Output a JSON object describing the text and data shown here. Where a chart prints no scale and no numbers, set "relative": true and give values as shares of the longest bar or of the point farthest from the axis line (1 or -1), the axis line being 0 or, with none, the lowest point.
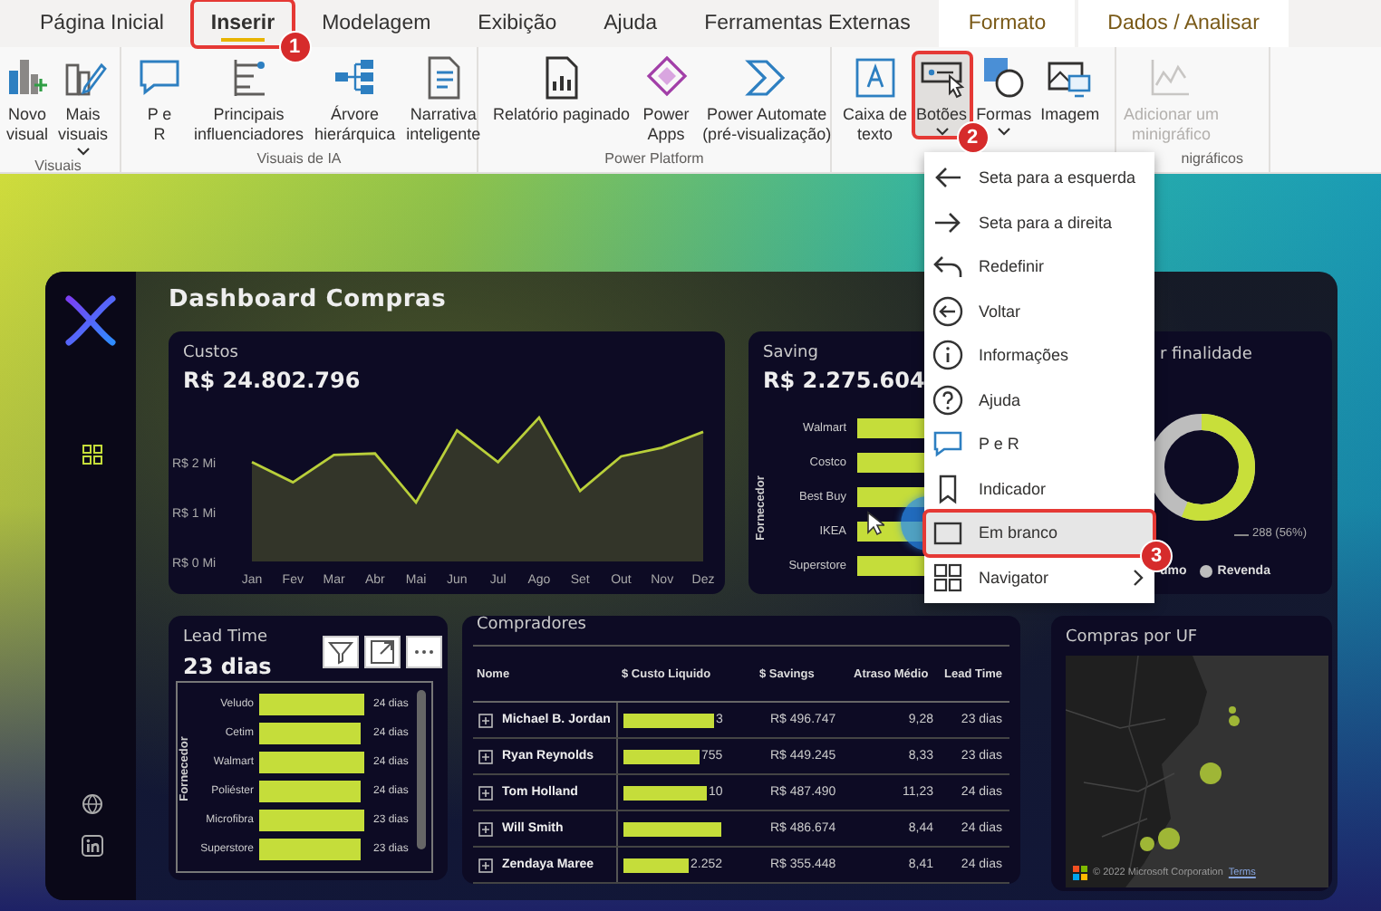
{
  "tabs": [
    {
      "label": "Página Inicial",
      "selected": false,
      "kind": "tab"
    },
    {
      "label": "Inserir",
      "selected": true,
      "kind": "tab",
      "callout": "1"
    },
    {
      "label": "Modelagem",
      "selected": false,
      "kind": "tab"
    },
    {
      "label": "Exibição",
      "selected": false,
      "kind": "tab"
    },
    {
      "label": "Ajuda",
      "selected": false,
      "kind": "tab"
    },
    {
      "label": "Ferramentas Externas",
      "selected": false,
      "kind": "tab"
    },
    {
      "label": "Formato",
      "selected": false,
      "kind": "contextual"
    },
    {
      "label": "Dados / Analisar",
      "selected": false,
      "kind": "contextual"
    }
  ],
  "ribbon": {
    "groups": [
      {
        "label": "Visuais",
        "items": [
          {
            "label": "Novo\nvisual",
            "dropdown": false,
            "disabled": false
          },
          {
            "label": "Mais\nvisuais",
            "dropdown": true,
            "disabled": false
          }
        ]
      },
      {
        "label": "Visuais de IA",
        "items": [
          {
            "label": "P e\nR",
            "dropdown": false,
            "disabled": false
          },
          {
            "label": "Principais\ninfluenciadores",
            "dropdown": false,
            "disabled": false
          },
          {
            "label": "Árvore\nhierárquica",
            "dropdown": false,
            "disabled": false
          },
          {
            "label": "Narrativa\ninteligente",
            "dropdown": false,
            "disabled": false
          }
        ]
      },
      {
        "label": "Power Platform",
        "items": [
          {
            "label": "Relatório paginado",
            "dropdown": false,
            "disabled": false
          },
          {
            "label": "Power\nApps",
            "dropdown": false,
            "disabled": false
          },
          {
            "label": "Power Automate\n(pré-visualização)",
            "dropdown": false,
            "disabled": false
          }
        ]
      },
      {
        "items": [
          {
            "label": "Caixa de\ntexto",
            "dropdown": false,
            "disabled": false
          },
          {
            "label": "Botões",
            "dropdown": true,
            "disabled": false,
            "callout": "2"
          },
          {
            "label": "Formas",
            "dropdown": true,
            "disabled": false
          },
          {
            "label": "Imagem",
            "dropdown": false,
            "disabled": false
          }
        ]
      },
      {
        "label": "nigráficos",
        "items": [
          {
            "label": "Adicionar um\nminigráfico",
            "dropdown": false,
            "disabled": true
          }
        ]
      }
    ]
  },
  "menu": {
    "items": [
      {
        "label": "Seta para a esquerda",
        "selected": false,
        "submenu": false
      },
      {
        "label": "Seta para a direita",
        "selected": false,
        "submenu": false
      },
      {
        "label": "Redefinir",
        "selected": false,
        "submenu": false
      },
      {
        "label": "Voltar",
        "selected": false,
        "submenu": false
      },
      {
        "label": "Informações",
        "selected": false,
        "submenu": false
      },
      {
        "label": "Ajuda",
        "selected": false,
        "submenu": false
      },
      {
        "label": "P e R",
        "selected": false,
        "submenu": false
      },
      {
        "label": "Indicador",
        "selected": false,
        "submenu": false
      },
      {
        "label": "Em branco",
        "selected": true,
        "submenu": false,
        "callout": "3"
      },
      {
        "label": "Navigator",
        "selected": false,
        "submenu": true
      }
    ]
  },
  "dashboard": {
    "title": "Dashboard Compras",
    "custos": {
      "title": "Custos",
      "value": "R$ 24.802.796",
      "chart_data": {
        "type": "area",
        "categories": [
          "Jan",
          "Fev",
          "Mar",
          "Abr",
          "Mai",
          "Jun",
          "Jul",
          "Ago",
          "Set",
          "Out",
          "Nov",
          "Dez"
        ],
        "series": [
          {
            "color": "#b9cf3a",
            "values": [
              0.69,
              0.55,
              0.74,
              0.75,
              0.41,
              0.91,
              0.69,
              1.0,
              0.49,
              0.73,
              0.79,
              0.9
            ]
          }
        ],
        "relative": true
      },
      "y_labels": [
        "R$ 2 Mi",
        "R$ 1 Mi",
        "R$ 0 Mi"
      ]
    },
    "saving": {
      "title": "Saving",
      "value": "R$ 2.275.604",
      "axis_label": "Fornecedor",
      "categories": [
        "Walmart",
        "Costco",
        "Best Buy",
        "IKEA",
        "Superstore"
      ]
    },
    "finalidade": {
      "title": "r finalidade",
      "data_label": "288 (56%)",
      "legend": [
        {
          "label": "umo"
        },
        {
          "label": "Revenda",
          "color": "#bdbdbd"
        }
      ]
    },
    "lead_time": {
      "title": "Lead Time",
      "value": "23 dias",
      "axis_label": "Fornecedor",
      "bars": [
        {
          "label": "Veludo",
          "reading": "24 dias"
        },
        {
          "label": "Cetim",
          "reading": "24 dias"
        },
        {
          "label": "Walmart",
          "reading": "24 dias"
        },
        {
          "label": "Poliéster",
          "reading": "24 dias"
        },
        {
          "label": "Microfibra",
          "reading": "23 dias"
        },
        {
          "label": "Superstore",
          "reading": "23 dias"
        }
      ]
    },
    "compradores": {
      "title": "Compradores",
      "columns": [
        "Nome",
        "$ Custo Liquido",
        "$ Savings",
        "Atraso Médio",
        "Lead Time"
      ],
      "rows": [
        {
          "expanded": false,
          "nome": "Michael B. Jordan",
          "custo": "3",
          "savings": "R$ 496.747",
          "atraso": "9,28",
          "lead": "23 dias"
        },
        {
          "expanded": false,
          "nome": "Ryan Reynolds",
          "custo": "755",
          "savings": "R$ 449.245",
          "atraso": "8,33",
          "lead": "23 dias"
        },
        {
          "expanded": false,
          "nome": "Tom Holland",
          "custo": "10",
          "savings": "R$ 487.490",
          "atraso": "11,23",
          "lead": "24 dias"
        },
        {
          "expanded": false,
          "nome": "Will Smith",
          "savings": "R$ 486.674",
          "atraso": "8,44",
          "lead": "24 dias"
        },
        {
          "expanded": false,
          "nome": "Zendaya Maree",
          "custo": "2.252",
          "savings": "R$ 355.448",
          "atraso": "8,41",
          "lead": "24 dias"
        }
      ]
    },
    "uf": {
      "title": "Compras por UF",
      "attribution": "© 2022 Microsoft Corporation",
      "terms": "Terms"
    }
  }
}
